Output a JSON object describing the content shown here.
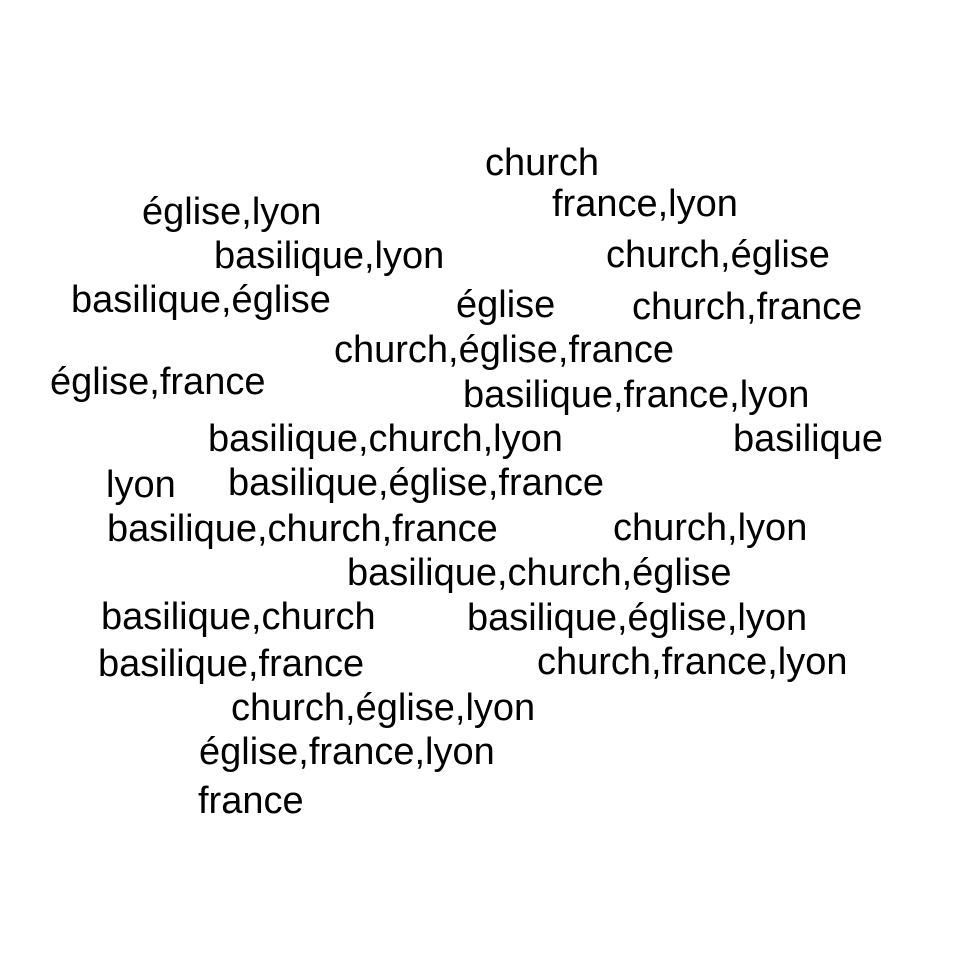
{
  "words": [
    "church",
    "église,lyon",
    "france,lyon",
    "basilique,lyon",
    "church,église",
    "basilique,église",
    "église",
    "church,france",
    "church,église,france",
    "église,france",
    "basilique,france,lyon",
    "basilique,church,lyon",
    "basilique",
    "lyon",
    "basilique,église,france",
    "basilique,church,france",
    "church,lyon",
    "basilique,church,église",
    "basilique,church",
    "basilique,église,lyon",
    "basilique,france",
    "church,france,lyon",
    "church,église,lyon",
    "église,france,lyon",
    "france"
  ]
}
